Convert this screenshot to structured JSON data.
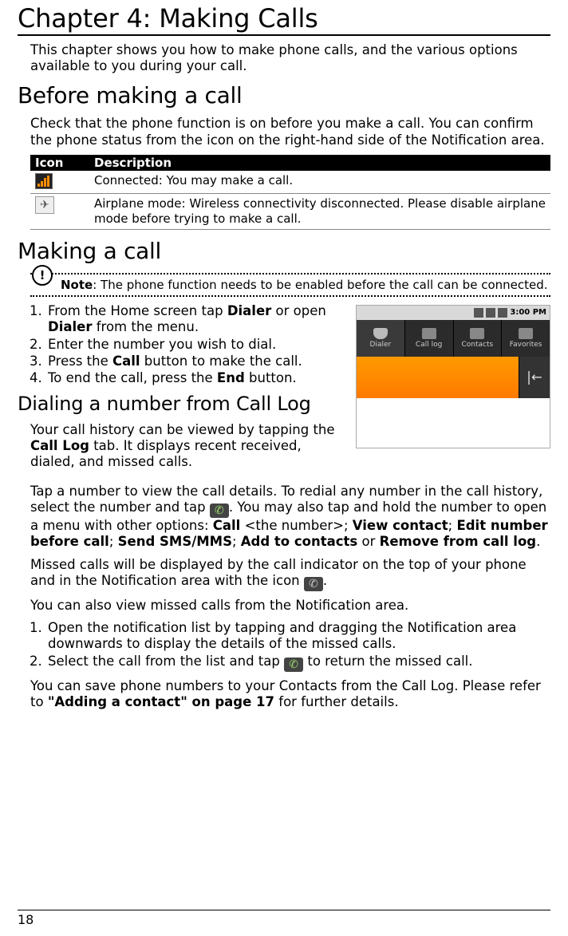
{
  "chapter_title": "Chapter 4: Making Calls",
  "intro": "This chapter shows you how to make phone calls, and the various options available to you during your call.",
  "section_before": {
    "title": "Before making a call",
    "text": "Check that the phone function is on before you make a call. You can confirm the phone status from the icon on the right-hand side of the Notification area.",
    "table_headers": {
      "icon": "Icon",
      "desc": "Description"
    },
    "rows": [
      {
        "desc": "Connected: You may make a call."
      },
      {
        "desc": "Airplane mode: Wireless connectivity disconnected. Please disable airplane mode before trying to make a call."
      }
    ]
  },
  "section_making": {
    "title": "Making a call",
    "note_label": "Note",
    "note_text": ": The phone function needs to be enabled before the call can be connected.",
    "steps_pre": [
      "From the Home screen tap ",
      " or open ",
      " from the menu."
    ],
    "kw": {
      "dialer1": "Dialer",
      "dialer2": "Dialer",
      "call": "Call",
      "end": "End",
      "calllog": "Call Log",
      "opt_call": "Call",
      "opt_num": " <the number>; ",
      "opt_view": "View contact",
      "opt_edit": "Edit number before call",
      "opt_sms": "Send SMS/MMS",
      "opt_add": "Add to contacts",
      "opt_rem": "Remove from call log",
      "ref": "\"Adding a contact\" on page 17"
    },
    "steps": [
      "Enter the number you wish to dial.",
      "Press the ",
      " button to make the call.",
      "To end the call, press the ",
      " button."
    ],
    "screenshot": {
      "time": "3:00 PM",
      "tabs": [
        "Dialer",
        "Call log",
        "Contacts",
        "Favorites"
      ]
    }
  },
  "section_calllog": {
    "title": "Dialing a number from Call Log",
    "p1a": "Your call history can be viewed by tapping the ",
    "p1b": " tab. It displays recent received, dialed, and missed calls.",
    "p2a": "Tap a number to view the call details. To redial any number in the call history, select the number and tap ",
    "p2b": ". You may also tap and hold the number to open a menu with other options: ",
    "p2_sep1": "; ",
    "p2_sep2": "; ",
    "p2_sep3": "; ",
    "p2_or": " or ",
    "p2_end": ".",
    "p3a": "Missed calls will be displayed by the call indicator on the top of your phone and in the Notification area with the icon ",
    "p3b": ".",
    "p4": "You can also view missed calls from the Notification area.",
    "steps": [
      "Open the notification list by tapping and dragging the Notification area downwards to display the details of the missed calls.",
      "Select the call from the list and tap ",
      " to return the missed call."
    ],
    "p5a": "You can save phone numbers to your Contacts from the Call Log. Please refer to ",
    "p5b": " for further details."
  },
  "page_number": "18"
}
